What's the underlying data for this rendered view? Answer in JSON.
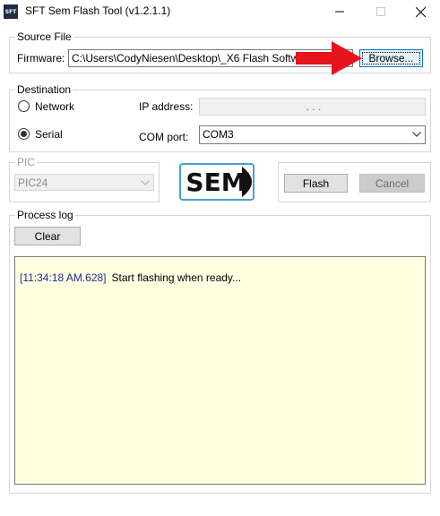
{
  "window": {
    "icon_text": "SFT",
    "title": "SFT Sem Flash Tool  (v1.2.1.1)",
    "min_glyph": "—",
    "max_glyph": "☐",
    "close_glyph": "✕"
  },
  "source_file": {
    "legend": "Source File",
    "firmware_label": "Firmware:",
    "firmware_value": "C:\\Users\\CodyNiesen\\Desktop\\_X6 Flash Software\\",
    "browse_label": "Browse..."
  },
  "destination": {
    "legend": "Destination",
    "network_label": "Network",
    "serial_label": "Serial",
    "selected": "serial",
    "ip_label": "IP address:",
    "ip_value": ".   .   .",
    "com_label": "COM port:",
    "com_value": "COM3"
  },
  "pic": {
    "legend": "PIC",
    "value": "PIC24"
  },
  "logo": {
    "text": "SEM"
  },
  "actions": {
    "flash_label": "Flash",
    "cancel_label": "Cancel"
  },
  "process_log": {
    "legend": "Process log",
    "clear_label": "Clear",
    "entries": [
      {
        "time": "[11:34:18 AM.628]",
        "message": "Start flashing when ready..."
      }
    ]
  },
  "colors": {
    "log_background": "#ffffe1",
    "timestamp": "#1e2c8c",
    "annotation_arrow": "#e8141c",
    "focus_border": "#0078d7"
  }
}
